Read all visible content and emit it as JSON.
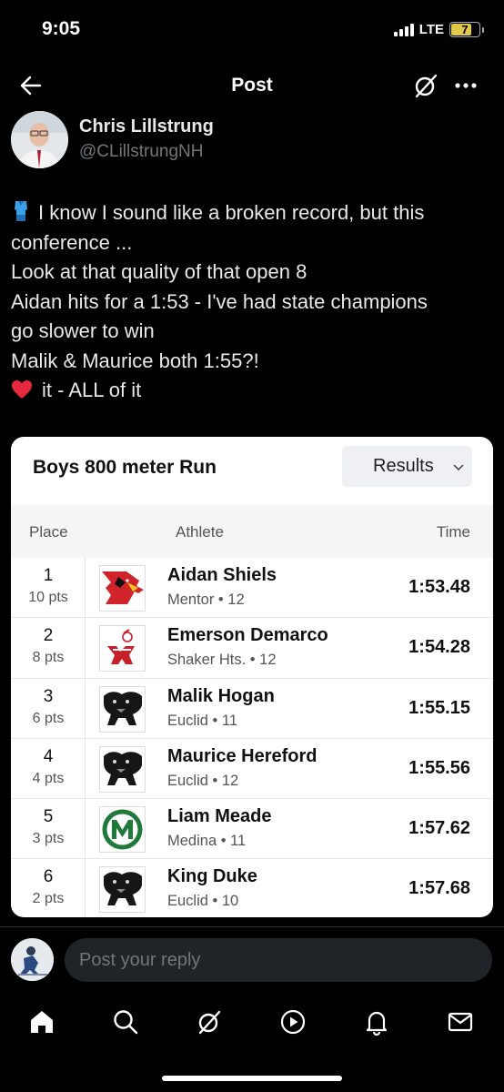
{
  "status_bar": {
    "time": "9:05",
    "network": "LTE",
    "battery": "7"
  },
  "nav": {
    "title": "Post"
  },
  "author": {
    "name": "Chris Lillstrung",
    "handle": "@CLillstrungNH"
  },
  "post": {
    "lines": [
      "I know I sound like a broken record, but this",
      "conference ...",
      "Look at that quality of that open 8",
      "Aidan hits for a 1:53 - I've had state champions",
      "go slower to win",
      "Malik & Maurice both 1:55?!",
      "it - ALL of it"
    ],
    "emojis": [
      "shirt-emoji",
      "heart-emoji"
    ]
  },
  "card": {
    "title": "Boys 800 meter Run",
    "dropdown": "Results",
    "headers": {
      "place": "Place",
      "athlete": "Athlete",
      "time": "Time"
    },
    "rows": [
      {
        "place": "1",
        "pts": "10 pts",
        "athlete": "Aidan Shiels",
        "school": "Mentor • 12",
        "time": "1:53.48",
        "logo": "cardinal-logo"
      },
      {
        "place": "2",
        "pts": "8 pts",
        "athlete": "Emerson Demarco",
        "school": "Shaker Hts. • 12",
        "time": "1:54.28",
        "logo": "raider-logo"
      },
      {
        "place": "3",
        "pts": "6 pts",
        "athlete": "Malik Hogan",
        "school": "Euclid • 11",
        "time": "1:55.15",
        "logo": "panther-logo"
      },
      {
        "place": "4",
        "pts": "4 pts",
        "athlete": "Maurice Hereford",
        "school": "Euclid • 12",
        "time": "1:55.56",
        "logo": "panther-logo"
      },
      {
        "place": "5",
        "pts": "3 pts",
        "athlete": "Liam Meade",
        "school": "Medina • 11",
        "time": "1:57.62",
        "logo": "medina-m-logo"
      },
      {
        "place": "6",
        "pts": "2 pts",
        "athlete": "King Duke",
        "school": "Euclid • 10",
        "time": "1:57.68",
        "logo": "panther-logo"
      }
    ]
  },
  "reply": {
    "placeholder": "Post your reply"
  },
  "tabbar": {
    "icons": [
      "home-icon",
      "search-icon",
      "grok-icon",
      "video-icon",
      "notifications-icon",
      "messages-icon"
    ]
  },
  "colors": {
    "background": "#000000",
    "text": "#e7e9ea",
    "muted": "#71767b",
    "card": "#ffffff",
    "input": "#202327"
  }
}
